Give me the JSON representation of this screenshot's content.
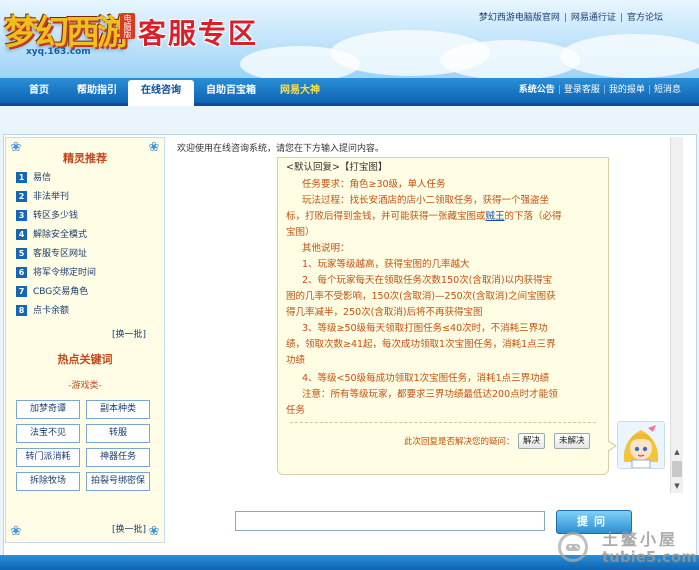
{
  "header": {
    "logo_text": "梦幻西游",
    "logo_badge": "电脑版",
    "logo_url": "xyq.163.com",
    "title": "客服专区",
    "top_links": [
      "梦幻西游电脑版官网",
      "网易通行证",
      "官方论坛"
    ]
  },
  "nav": {
    "items": [
      "首页",
      "帮助指引",
      "在线咨询",
      "自助百宝箱",
      "网易大神"
    ],
    "active": "在线咨询",
    "right_links": [
      "系统公告",
      "登录客服",
      "我的报单",
      "短消息"
    ]
  },
  "sidebar": {
    "jingling_title": "精灵推荐",
    "jingling_items": [
      {
        "num": "1",
        "label": "易信"
      },
      {
        "num": "2",
        "label": "非法举刊"
      },
      {
        "num": "3",
        "label": "转区多少钱"
      },
      {
        "num": "4",
        "label": "解除安全模式"
      },
      {
        "num": "5",
        "label": "客服专区网址"
      },
      {
        "num": "6",
        "label": "将军令绑定时间"
      },
      {
        "num": "7",
        "label": "CBG交易角色"
      },
      {
        "num": "8",
        "label": "点卡余额"
      }
    ],
    "refresh_label": "[换一批]",
    "hot_title": "热点关键词",
    "game_category": "-游戏类-",
    "keywords": [
      "加梦奇谭",
      "副本种类",
      "法宝不见",
      "转服",
      "转门派消耗",
      "神器任务",
      "拆除牧场",
      "拍裂号绑密保"
    ],
    "refresh_label_2": "[换一批]"
  },
  "chat": {
    "welcome": "欢迎使用在线咨询系统，请您在下方输入提问内容。",
    "reply_title": "<默认回复>【打宝图】",
    "lines": [
      "任务要求：角色≥30级，单人任务",
      "玩法过程：找长安酒店的店小二领取任务，获得一个强盗坐",
      "标，打败后得到金钱，并可能获得一张藏宝图或",
      "宝图）",
      "其他说明：",
      "1、玩家等级越高，获得宝图的几率越大",
      "2、每个玩家每天在领取任务次数150次(含取消)以内获得宝",
      "图的几率不受影响，150次(含取消)—250次(含取消)之间宝图获",
      "得几率减半，250次(含取消)后将不再获得宝图",
      "3、等级≥50级每天领取打图任务≤40次时，不消耗三界功",
      "绩，领取次数≥41起，每次成功领取1次宝图任务，消耗1点三界",
      "功绩",
      "4、等级<50级每成功领取1次宝图任务，消耗1点三界功绩",
      "注意：所有等级玩家，都要求三界功绩最低达200点时才能领",
      "任务"
    ],
    "link_text": "贼王",
    "link_suffix": "的下落（必得",
    "resolve_question": "此次回复是否解决您的疑问：",
    "resolved_label": "解决",
    "unresolved_label": "未解决"
  },
  "input": {
    "value": "",
    "ask_label": "提问"
  },
  "watermark": {
    "line1": "土鳖小屋",
    "line2": "tubie5.com"
  }
}
